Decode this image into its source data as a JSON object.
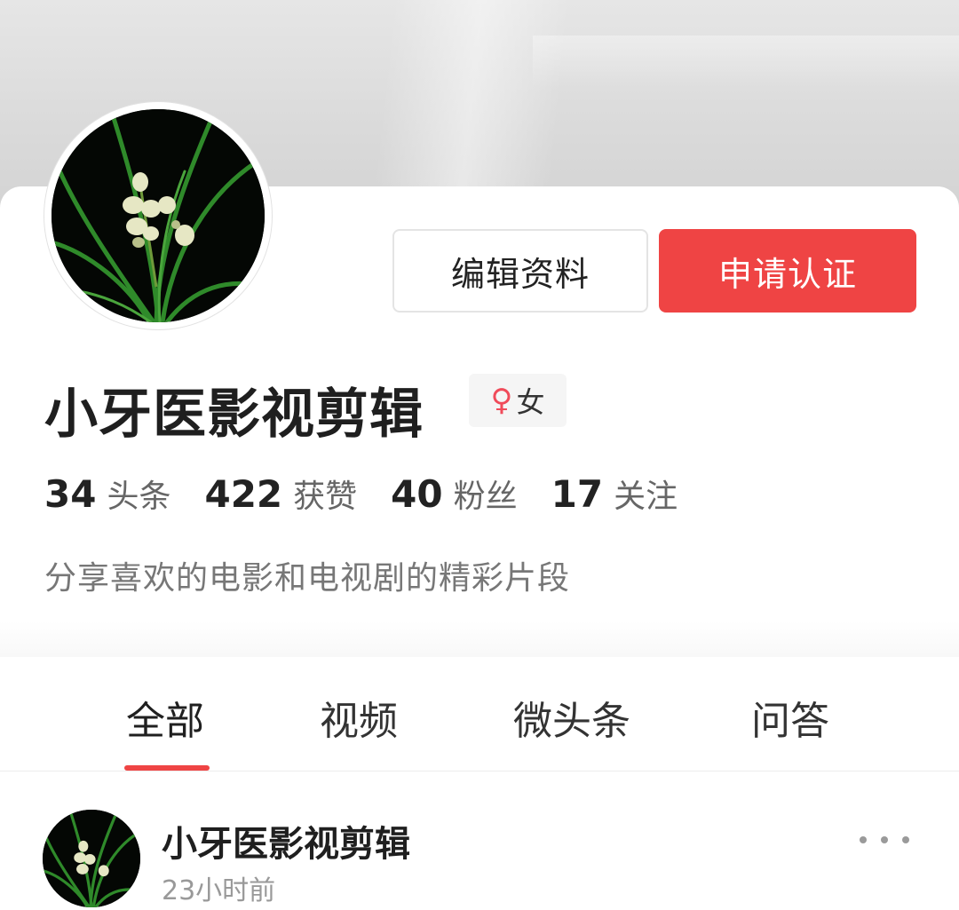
{
  "profile": {
    "edit_button": "编辑资料",
    "verify_button": "申请认证",
    "name": "小牙医影视剪辑",
    "gender_symbol": "♀",
    "gender_label": "女",
    "bio": "分享喜欢的电影和电视剧的精彩片段"
  },
  "stats": [
    {
      "num": "34",
      "label": "头条"
    },
    {
      "num": "422",
      "label": "获赞"
    },
    {
      "num": "40",
      "label": "粉丝"
    },
    {
      "num": "17",
      "label": "关注"
    }
  ],
  "tabs": [
    {
      "label": "全部",
      "active": true
    },
    {
      "label": "视频",
      "active": false
    },
    {
      "label": "微头条",
      "active": false
    },
    {
      "label": "问答",
      "active": false
    }
  ],
  "post": {
    "author": "小牙医影视剪辑",
    "time": "23小时前"
  },
  "icons": {
    "avatar": "orchid-image",
    "more": "more-dots-icon",
    "gender": "female-symbol-icon"
  },
  "colors": {
    "accent": "#ef4444",
    "gender_symbol": "#f04b5a"
  }
}
